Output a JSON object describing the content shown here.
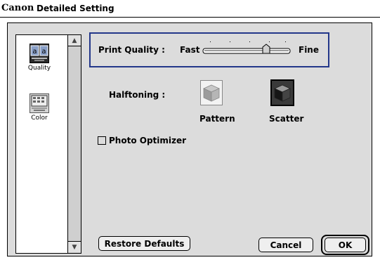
{
  "title": {
    "brand": "Canon",
    "text": "Detailed Setting"
  },
  "sidebar": {
    "items": [
      {
        "label": "Quality",
        "icon": "quality-icon",
        "selected": true
      },
      {
        "label": "Color",
        "icon": "color-icon",
        "selected": false
      }
    ]
  },
  "print_quality": {
    "label": "Print Quality :",
    "min_label": "Fast",
    "max_label": "Fine",
    "level": 0.75
  },
  "halftoning": {
    "label": "Halftoning :",
    "options": [
      {
        "label": "Pattern",
        "icon": "pattern-cube-icon",
        "selected": false
      },
      {
        "label": "Scatter",
        "icon": "scatter-cube-icon",
        "selected": true
      }
    ]
  },
  "photo_optimizer": {
    "label": "Photo Optimizer",
    "checked": false
  },
  "buttons": {
    "restore": "Restore Defaults",
    "cancel": "Cancel",
    "ok": "OK"
  },
  "colors": {
    "frame_accent": "#23378a",
    "dialog_bg": "#dcdcdc"
  }
}
